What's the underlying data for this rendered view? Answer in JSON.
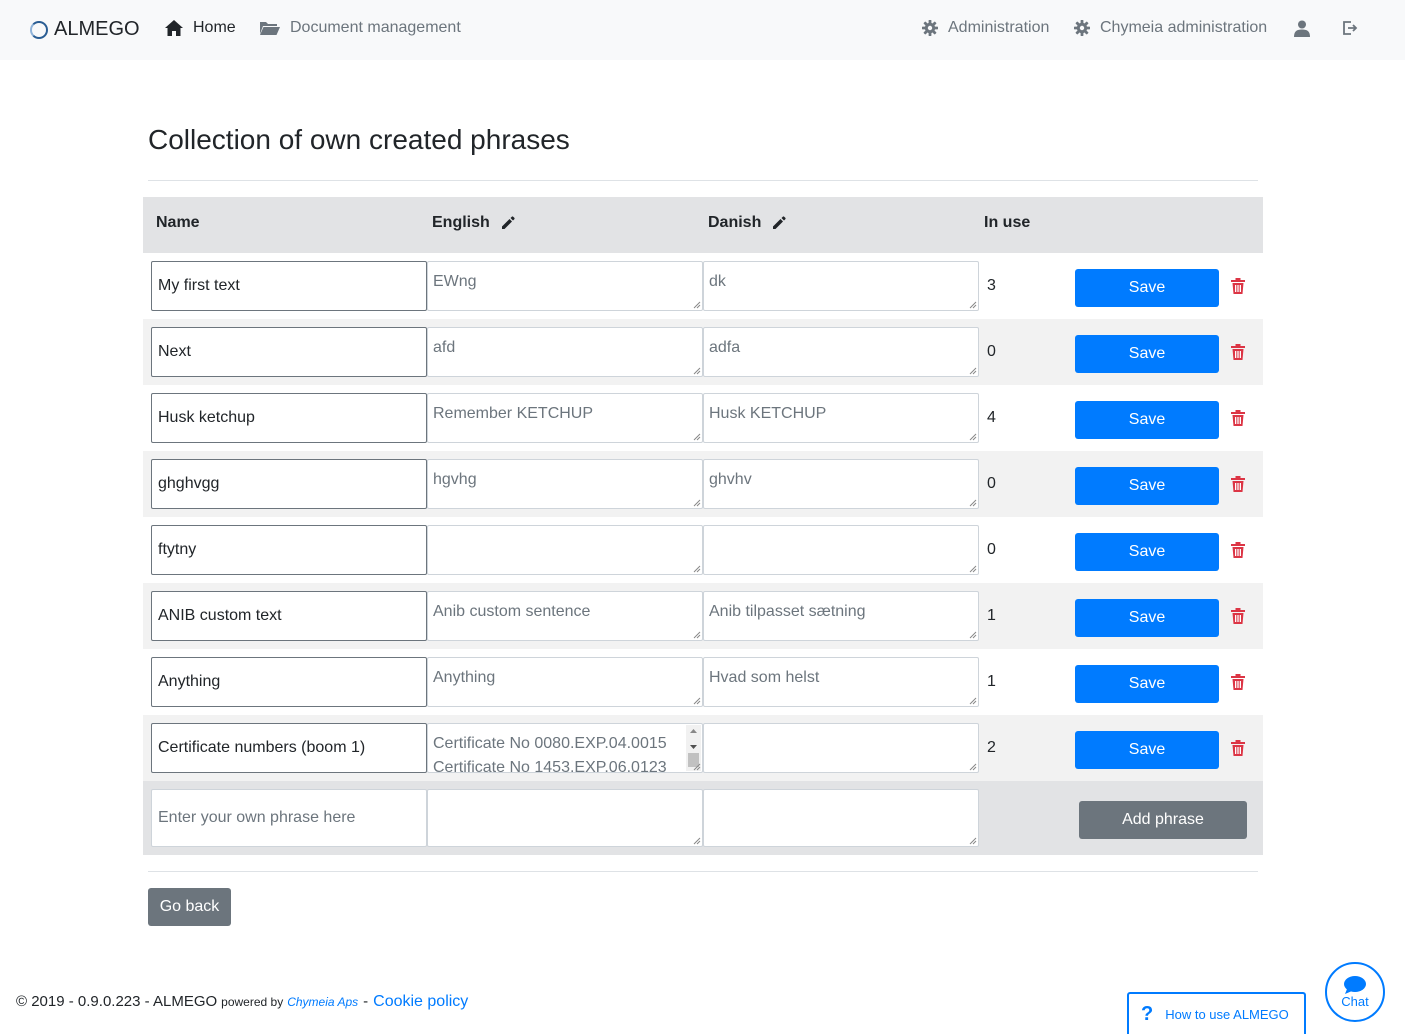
{
  "navbar": {
    "brand": "ALMEGO",
    "home": "Home",
    "document_management": "Document management",
    "administration": "Administration",
    "chymeia_administration": "Chymeia administration"
  },
  "page": {
    "title": "Collection of own created phrases"
  },
  "table": {
    "headers": {
      "name": "Name",
      "english": "English",
      "danish": "Danish",
      "in_use": "In use"
    },
    "rows": [
      {
        "name": "My first text",
        "english": "EWng",
        "danish": "dk",
        "in_use": "3",
        "save": "Save"
      },
      {
        "name": "Next",
        "english": "afd",
        "danish": "adfa",
        "in_use": "0",
        "save": "Save"
      },
      {
        "name": "Husk ketchup",
        "english": "Remember KETCHUP",
        "danish": "Husk KETCHUP",
        "in_use": "4",
        "save": "Save"
      },
      {
        "name": "ghghvgg",
        "english": "hgvhg",
        "danish": "ghvhv",
        "in_use": "0",
        "save": "Save"
      },
      {
        "name": "ftytny",
        "english": "",
        "danish": "",
        "in_use": "0",
        "save": "Save"
      },
      {
        "name": "ANIB custom text",
        "english": "Anib custom sentence",
        "danish": "Anib tilpasset sætning",
        "in_use": "1",
        "save": "Save"
      },
      {
        "name": "Anything",
        "english": "Anything",
        "danish": "Hvad som helst",
        "in_use": "1",
        "save": "Save"
      },
      {
        "name": "Certificate numbers (boom 1)",
        "english_line1": "Certificate No 0080.EXP.04.0015",
        "english_line2": "Certificate No 1453.EXP.06.0123",
        "danish": "",
        "in_use": "2",
        "save": "Save"
      }
    ],
    "new_row": {
      "placeholder": "Enter your own phrase here",
      "add_label": "Add phrase"
    }
  },
  "buttons": {
    "go_back": "Go back"
  },
  "footer": {
    "copyright": "© 2019 - 0.9.0.223 - ALMEGO",
    "powered_by": "powered by",
    "company": "Chymeia Aps",
    "separator": "-",
    "cookie_policy": "Cookie policy"
  },
  "help": {
    "label": "How to use ALMEGO"
  },
  "chat": {
    "label": "Chat"
  },
  "colors": {
    "primary": "#007bff",
    "secondary": "#6c757d",
    "danger": "#dc3545",
    "header_bg": "#e2e3e5"
  }
}
